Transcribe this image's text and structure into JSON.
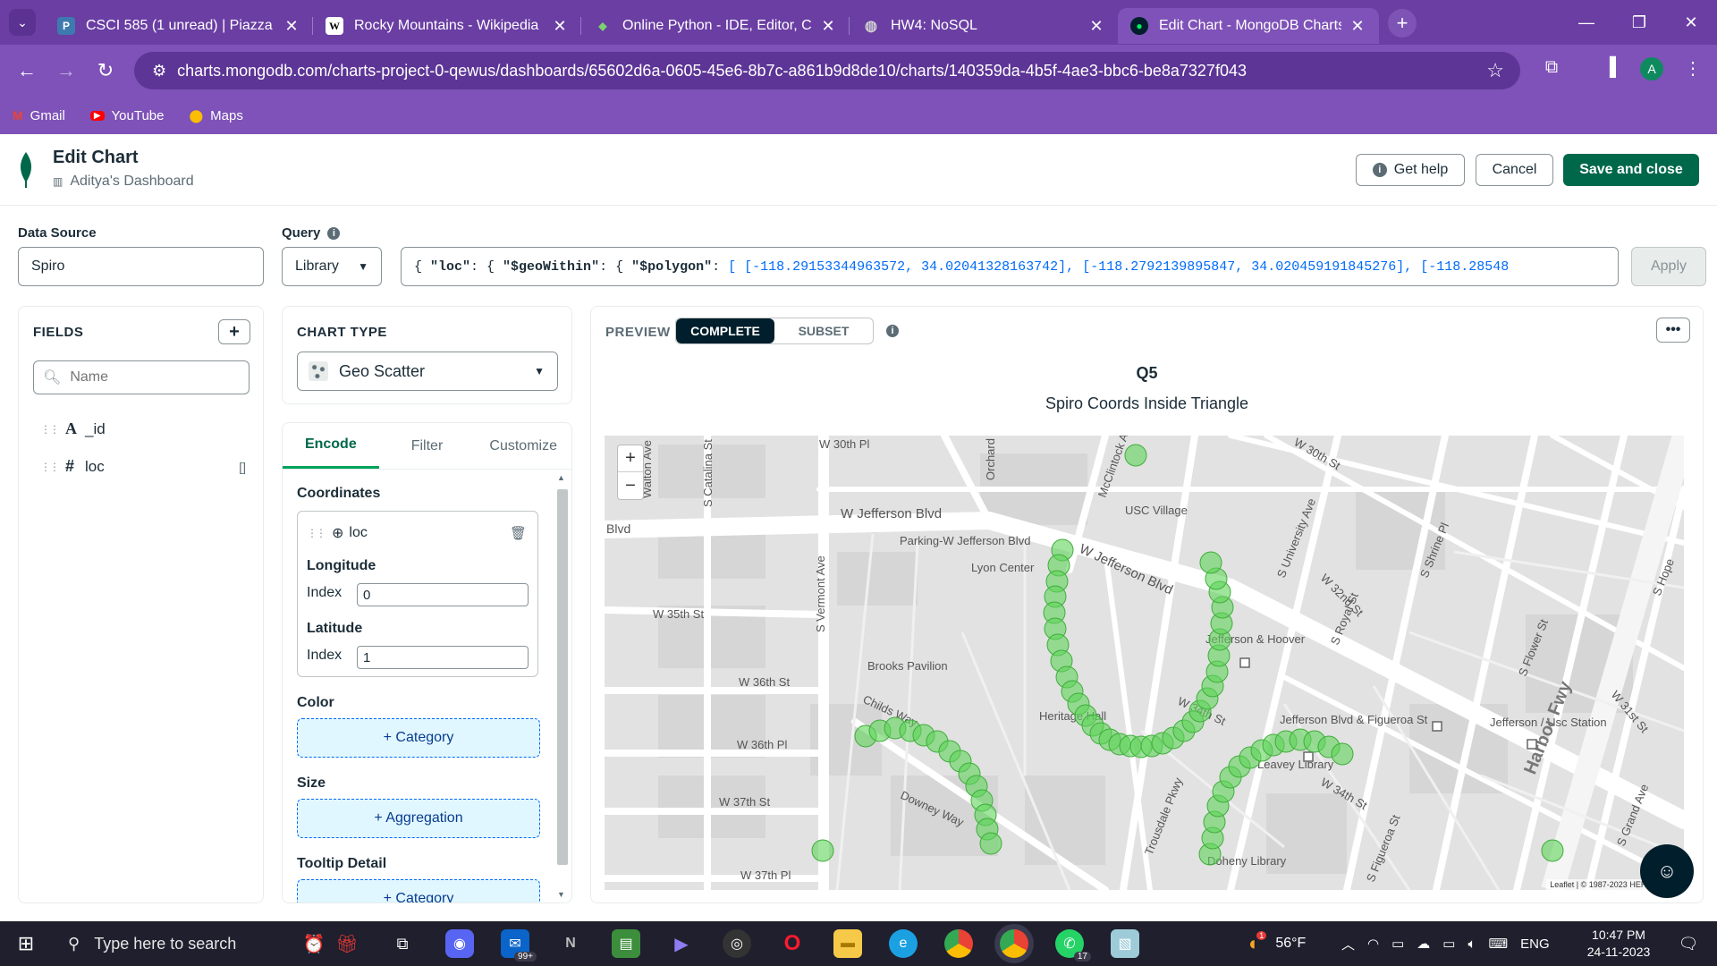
{
  "browser": {
    "tabs": [
      {
        "title": "CSCI 585 (1 unread) | Piazza Q&A",
        "favicon": "P",
        "color": "#3e7ab0"
      },
      {
        "title": "Rocky Mountains - Wikipedia",
        "favicon": "W",
        "color": "#ffffff"
      },
      {
        "title": "Online Python - IDE, Editor, Co",
        "favicon": "◆",
        "color": "#4caf50"
      },
      {
        "title": "HW4: NoSQL",
        "favicon": "●",
        "color": "#9e9e9e"
      },
      {
        "title": "Edit Chart - MongoDB Charts",
        "favicon": "●",
        "color": "#00ed64"
      }
    ],
    "url": "charts.mongodb.com/charts-project-0-qewus/dashboards/65602d6a-0605-45e6-8b7c-a861b9d8de10/charts/140359da-4b5f-4ae3-bbc6-be8a7327f043",
    "profile_initial": "A",
    "bookmarks": [
      {
        "label": "Gmail",
        "icon": "M",
        "color": "#ea4335"
      },
      {
        "label": "YouTube",
        "icon": "▶",
        "color": "#ff0000"
      },
      {
        "label": "Maps",
        "icon": "⬤",
        "color": "#34a853"
      }
    ]
  },
  "header": {
    "title": "Edit Chart",
    "dashboard": "Aditya's Dashboard",
    "get_help": "Get help",
    "cancel": "Cancel",
    "save": "Save and close"
  },
  "datasource": {
    "label": "Data Source",
    "value": "Spiro"
  },
  "query": {
    "label": "Query",
    "preset": "Library",
    "text_prefix": "{ ",
    "key1": "\"loc\"",
    "key2": "\"$geoWithin\"",
    "key3": "\"$polygon\"",
    "coords": "[ [-118.29153344963572, 34.02041328163742], [-118.2792139895847, 34.020459191845276], [-118.28548",
    "apply": "Apply"
  },
  "fields": {
    "title": "FIELDS",
    "search_placeholder": "Name",
    "items": [
      {
        "type": "A",
        "name": "_id"
      },
      {
        "type": "#",
        "name": "loc",
        "suffix": "[]"
      }
    ]
  },
  "chart_type": {
    "title": "CHART TYPE",
    "value": "Geo Scatter"
  },
  "encode": {
    "tabs": [
      "Encode",
      "Filter",
      "Customize"
    ],
    "coordinates_label": "Coordinates",
    "field": "loc",
    "longitude_label": "Longitude",
    "latitude_label": "Latitude",
    "index_label": "Index",
    "longitude_index": "0",
    "latitude_index": "1",
    "color_label": "Color",
    "color_drop": "+ Category",
    "size_label": "Size",
    "size_drop": "+ Aggregation",
    "tooltip_label": "Tooltip Detail",
    "tooltip_drop": "+ Category"
  },
  "preview": {
    "label": "PREVIEW",
    "complete": "COMPLETE",
    "subset": "SUBSET",
    "chart_title": "Q5",
    "chart_subtitle": "Spiro Coords Inside Triangle",
    "attribution": "Leaflet | © 1987-2023 HERE | Terms",
    "marker_color": "#5fd35a",
    "map_labels": [
      "W 30th Pl",
      "Walton Ave",
      "W Jefferson Blvd",
      "USC Village",
      "McClintock Ave",
      "S Catalina St",
      "Blvd",
      "Parking-W Jefferson Blvd",
      "Lyon Center",
      "W Jefferson Blvd",
      "W 35th St",
      "S Vermont Ave",
      "Brooks Pavilion",
      "W 36th St",
      "W 36th Pl",
      "W 37th St",
      "W 37th Pl",
      "Childs Way",
      "Downey Way",
      "Heritage Hall",
      "Jefferson & Hoover",
      "S University Ave",
      "W 32nd St",
      "S Royal St",
      "Jefferson Blvd & Figueroa St",
      "Leavey Library",
      "W 34th St",
      "Doheny Library",
      "Trousdale Pkwy",
      "S Figueroa St",
      "Jefferson / Usc Station",
      "Harbor Fwy",
      "W 31st St",
      "S Flower St",
      "S Grand Ave",
      "W 30th St",
      "Orchard",
      "S Hope",
      "S Shrine Pl",
      "W 34th St"
    ]
  },
  "taskbar": {
    "search_placeholder": "Type here to search",
    "weather": "56°F",
    "lang": "ENG",
    "time": "10:47 PM",
    "date": "24-11-2023",
    "mail_badge": "99+",
    "whatsapp_badge": "17",
    "notif_badge": "1"
  }
}
